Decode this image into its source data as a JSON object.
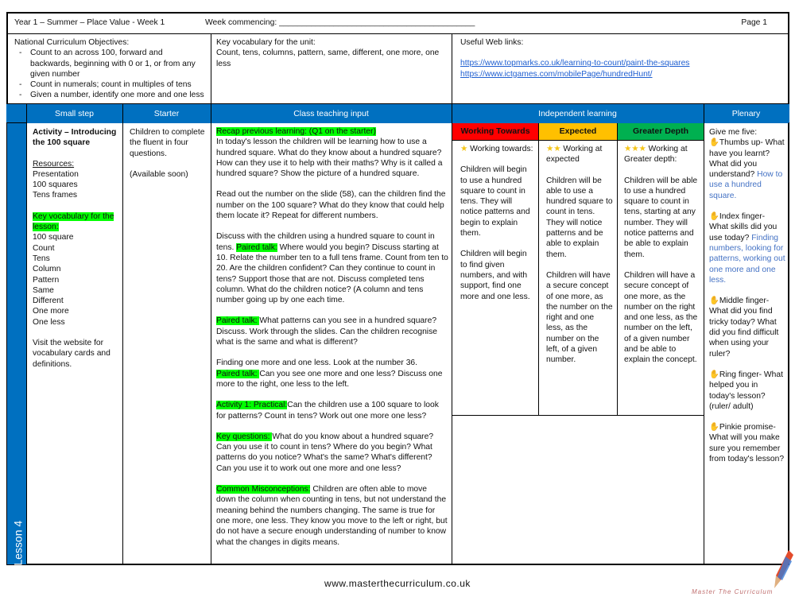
{
  "header": {
    "title": "Year 1 – Summer – Place Value - Week 1",
    "week_commencing": "Week commencing: ___________________________________________",
    "page": "Page 1"
  },
  "objectives": {
    "heading": "National Curriculum Objectives:",
    "items": [
      "Count to an across 100, forward and backwards, beginning with 0 or 1, or from any given number",
      "Count in numerals; count in multiples of tens",
      "Given a number, identify one more and one less"
    ]
  },
  "vocab_unit": {
    "heading": "Key vocabulary for the unit:",
    "text": "Count, tens, columns, pattern, same, different, one more, one less"
  },
  "web_links": {
    "heading": "Useful Web links:",
    "links": [
      "https://www.topmarks.co.uk/learning-to-count/paint-the-squares",
      "https://www.ictgames.com/mobilePage/hundredHunt/"
    ]
  },
  "columns": {
    "small_step": "Small step",
    "starter": "Starter",
    "class_input": "Class teaching input",
    "independent": "Independent learning",
    "plenary": "Plenary"
  },
  "lesson_label": "Lesson 4",
  "small_step": {
    "title": "Activity – Introducing the 100 square",
    "resources_heading": "Resources:",
    "resources": [
      "Presentation",
      "100 squares",
      "Tens frames"
    ],
    "vocab_heading": "Key vocabulary for the lesson:",
    "vocab": [
      "100 square",
      "Count",
      "Tens",
      "Column",
      "Pattern",
      "Same",
      "Different",
      "One more",
      "One less"
    ],
    "note": "Visit the website for vocabulary cards and definitions."
  },
  "starter": {
    "text": "Children to complete the fluent in four questions.",
    "note": "(Available soon)"
  },
  "class_input": {
    "recap": "Recap previous learning: (Q1 on the starter)",
    "p1": "In today's lesson the children will be learning how to use a hundred square. What do they know about a hundred square? How can they use it to help with their maths? Why is it called a hundred square? Show the picture of a hundred square.",
    "p2": "Read out the number on the slide (58), can the children find the number on the 100 square? What do they know that could help them locate it? Repeat for different numbers.",
    "p3a": "Discuss with the children using a hundred square to count in tens. ",
    "p3_label": "Paired talk:",
    "p3b": " Where would you begin? Discuss starting at 10. Relate the number ten to a full tens frame. Count from ten to 20. Are the children confident? Can they continue to count in tens? Support those that are not. Discuss completed tens column. What do the children notice? (A column and tens number going up by one each time.",
    "p4_label": "Paired talk: ",
    "p4": " What patterns can you see in a hundred square? Discuss. Work through the slides. Can the children recognise what is the same and what is different?",
    "p5": "Finding one more and one less. Look at the number 36.",
    "p5_label": "Paired talk: ",
    "p5b": " Can you see one more and one less? Discuss one more to the right, one less to the left.",
    "p6_label": "Activity 1: Practical:",
    "p6": "Can the children use a 100 square to look for patterns? Count in tens? Work out one more one less?",
    "p7_label": "Key questions: ",
    "p7": " What do you know about a hundred square? Can you use it to count in tens? Where do you begin? What patterns do you notice? What's the same? What's different? Can you use it to work out one more and one less?",
    "p8_label": "Common Misconceptions:",
    "p8": " Children are often able to move down the column when counting in tens, but not understand the meaning behind the numbers changing. The same is true for one more, one less. They know you move to the left or right, but do not have a secure enough understanding of number to know what the changes in digits means."
  },
  "independent": [
    {
      "level": "Working Towards",
      "color": "#ff0000",
      "stars": "★",
      "intro": "Working towards:",
      "p1": "Children will begin to use a hundred square to count in tens. They will notice patterns and begin to explain them.",
      "p2": "Children will begin to find given numbers, and with support, find one more and one less."
    },
    {
      "level": "Expected",
      "color": "#ffc000",
      "stars": "★★",
      "intro": "Working at expected",
      "p1": "Children will be able to use a hundred square to count in tens. They will notice patterns and be able to explain them.",
      "p2": "Children will have a secure concept of one more, as the number on the right and one less, as the number on the left, of a given number."
    },
    {
      "level": "Greater Depth",
      "color": "#00b050",
      "stars": "★★★",
      "intro": "Working at Greater depth:",
      "p1": "Children will be able to use a hundred square to count in tens, starting at any number. They will notice patterns and be able to explain them.",
      "p2": "Children will have a secure concept of one more, as the number on the right and one less, as the number on the left, of a given number and be able to explain the concept."
    }
  ],
  "plenary": {
    "intro": "Give me five:",
    "items": [
      {
        "label": "Thumbs up- What have you learnt? What did you understand?",
        "answer": "How to use a hundred square."
      },
      {
        "label": "Index finger- What skills did you use today?",
        "answer": "Finding numbers, looking for patterns, working out one more and one less."
      },
      {
        "label": "Middle finger- What did you find tricky today? What did you find difficult when using your ruler?",
        "answer": ""
      },
      {
        "label": "Ring finger- What helped you in today's lesson? (ruler/ adult)",
        "answer": ""
      },
      {
        "label": "Pinkie promise- What will you make sure you remember from today's lesson?",
        "answer": ""
      }
    ]
  },
  "footer": {
    "url": "www.masterthecurriculum.co.uk",
    "logo_text": "Master The Curriculum"
  }
}
